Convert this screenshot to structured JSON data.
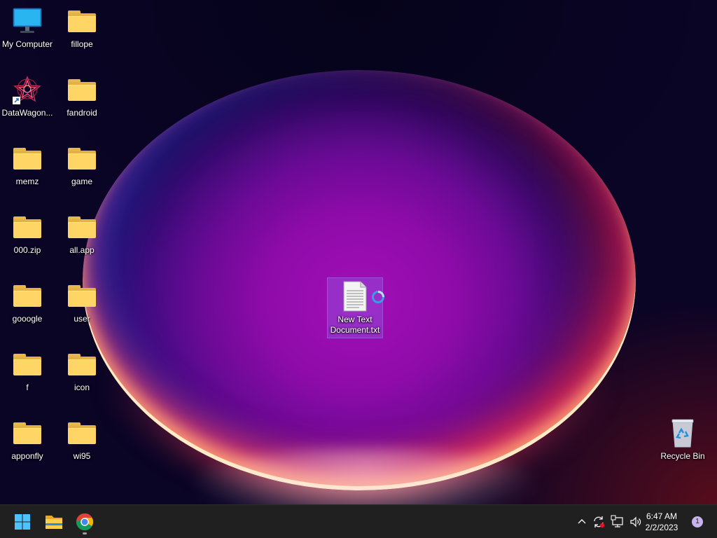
{
  "desktop": {
    "icons": [
      {
        "label": "My Computer",
        "icon": "computer-icon"
      },
      {
        "label": "fillope",
        "icon": "folder-icon"
      },
      {
        "label": "DataWagon...",
        "icon": "app-shortcut-icon"
      },
      {
        "label": "fandroid",
        "icon": "folder-icon"
      },
      {
        "label": "memz",
        "icon": "folder-icon"
      },
      {
        "label": "game",
        "icon": "folder-icon"
      },
      {
        "label": "000.zip",
        "icon": "folder-icon"
      },
      {
        "label": "all.app",
        "icon": "folder-icon"
      },
      {
        "label": "gooogle",
        "icon": "folder-icon"
      },
      {
        "label": "user",
        "icon": "folder-icon"
      },
      {
        "label": "f",
        "icon": "folder-icon"
      },
      {
        "label": "icon",
        "icon": "folder-icon"
      },
      {
        "label": "apponfly",
        "icon": "folder-icon"
      },
      {
        "label": "wi95",
        "icon": "folder-icon"
      }
    ],
    "selected_file": {
      "label_line1": "New Text",
      "label_line2": "Document.txt",
      "icon": "text-document-icon"
    },
    "recycle_bin": {
      "label": "Recycle Bin",
      "icon": "recycle-bin-icon"
    }
  },
  "taskbar": {
    "pinned": [
      {
        "name": "Start",
        "icon": "windows-start-icon"
      },
      {
        "name": "File Explorer",
        "icon": "file-explorer-icon"
      },
      {
        "name": "Google Chrome",
        "icon": "chrome-icon"
      }
    ],
    "tray_icons": [
      "chevron-up-icon",
      "sync-icon",
      "network-icon",
      "volume-icon"
    ],
    "time": "6:47 AM",
    "date": "2/2/2023",
    "notification_count": "1"
  },
  "colors": {
    "taskbar": "#202020",
    "folder": "#ffd666",
    "windows_blue": "#4cc2ff",
    "orb_purple": "#a20fb6"
  }
}
